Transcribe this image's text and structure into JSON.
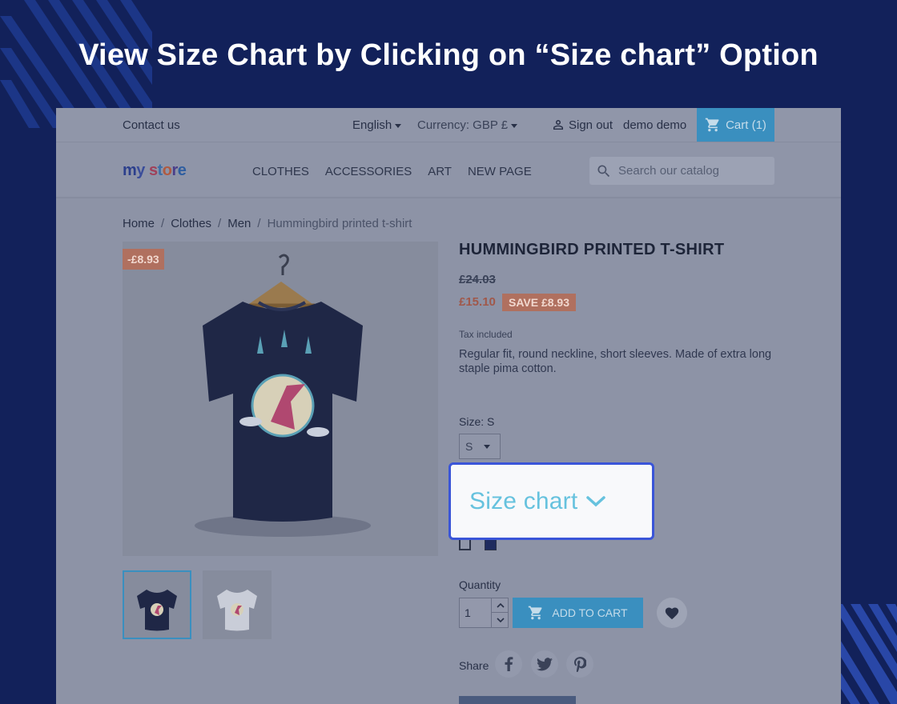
{
  "headline": "View Size Chart by Clicking on “Size chart” Option",
  "topbar": {
    "contact": "Contact us",
    "language": "English",
    "currency": "Currency: GBP £",
    "sign_out": "Sign out",
    "username": "demo demo",
    "cart": "Cart (1)"
  },
  "header": {
    "logo": "my store",
    "menu": [
      "CLOTHES",
      "ACCESSORIES",
      "ART",
      "NEW PAGE"
    ],
    "search_placeholder": "Search our catalog"
  },
  "breadcrumb": [
    "Home",
    "Clothes",
    "Men",
    "Hummingbird printed t-shirt"
  ],
  "product": {
    "discount_badge": "-£8.93",
    "title": "HUMMINGBIRD PRINTED T-SHIRT",
    "regular_price": "£24.03",
    "price": "£15.10",
    "save_badge": "SAVE £8.93",
    "tax_note": "Tax included",
    "description": "Regular fit, round neckline, short sleeves. Made of extra long staple pima cotton.",
    "size_label": "Size: S",
    "size_value": "S",
    "size_chart": "Size chart",
    "quantity_label": "Quantity",
    "quantity": "1",
    "add_to_cart": "ADD TO CART",
    "share_label": "Share"
  },
  "colors": {
    "background": "#12215a",
    "highlight_border": "#3a55d8",
    "size_chart_text": "#66c2de",
    "accent": "#3a8fbf"
  }
}
